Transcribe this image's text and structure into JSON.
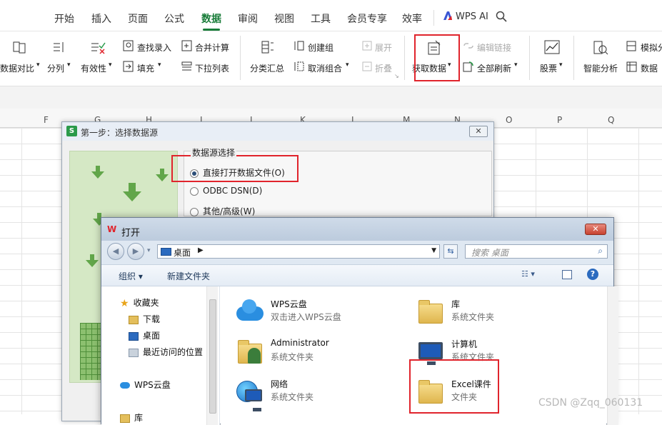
{
  "menu": {
    "tabs": [
      "开始",
      "插入",
      "页面",
      "公式",
      "数据",
      "审阅",
      "视图",
      "工具",
      "会员专享",
      "效率"
    ],
    "active": "数据",
    "wps_ai": "WPS AI"
  },
  "ribbon": {
    "compare": "数据对比",
    "split": "分列",
    "validity": "有效性",
    "lookup_entry": "查找录入",
    "fill": "填充",
    "merge_calc": "合并计算",
    "dropdown_list": "下拉列表",
    "subtotal": "分类汇总",
    "create_group": "创建组",
    "ungroup": "取消组合",
    "expand": "展开",
    "collapse": "折叠",
    "get_data": "获取数据",
    "edit_links": "编辑链接",
    "refresh_all": "全部刷新",
    "stocks": "股票",
    "smart_analysis": "智能分析",
    "simulate": "模拟分",
    "pivot": "数据"
  },
  "columns": [
    "F",
    "G",
    "H",
    "I",
    "J",
    "K",
    "L",
    "M",
    "N",
    "O",
    "P",
    "Q"
  ],
  "step_dialog": {
    "title": "第一步：选择数据源",
    "group_label": "数据源选择",
    "options": [
      "直接打开数据文件(O)",
      "ODBC DSN(D)",
      "其他/高级(W)"
    ],
    "selected_index": 0,
    "close": "✕"
  },
  "open_dialog": {
    "title": "打开",
    "close": "✕",
    "address": "桌面",
    "search_placeholder": "搜索 桌面",
    "organize": "组织 ▾",
    "new_folder": "新建文件夹",
    "nav": {
      "favorites": "收藏夹",
      "downloads": "下载",
      "desktop": "桌面",
      "recent": "最近访问的位置",
      "wps_cloud": "WPS云盘",
      "library": "库"
    },
    "files": [
      {
        "name": "WPS云盘",
        "desc": "双击进入WPS云盘"
      },
      {
        "name": "库",
        "desc": "系统文件夹"
      },
      {
        "name": "Administrator",
        "desc": "系统文件夹"
      },
      {
        "name": "计算机",
        "desc": "系统文件夹"
      },
      {
        "name": "网络",
        "desc": "系统文件夹"
      },
      {
        "name": "Excel课件",
        "desc": "文件夹"
      }
    ]
  },
  "watermark": "CSDN @Zqq_060131",
  "colors": {
    "accent": "#1a7d3a",
    "highlight": "#e0242c"
  }
}
